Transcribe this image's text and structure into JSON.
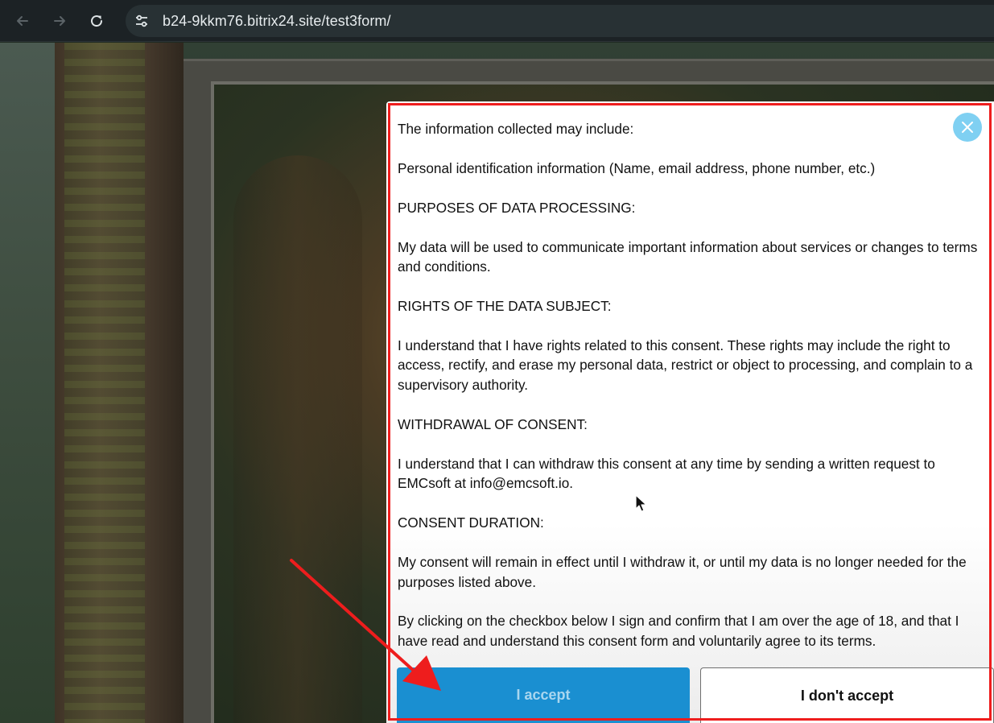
{
  "browser": {
    "url": "b24-9kkm76.bitrix24.site/test3form/"
  },
  "consent": {
    "paragraphs": [
      "The information collected may include:",
      "Personal identification information (Name, email address, phone number, etc.)",
      "PURPOSES OF DATA PROCESSING:",
      "My data will be used to communicate important information about services or changes to terms and conditions.",
      "RIGHTS OF THE DATA SUBJECT:",
      "I understand that I have rights related to this consent. These rights may include the right to access, rectify, and erase my personal data, restrict or object to processing, and complain to a supervisory authority.",
      "WITHDRAWAL OF CONSENT:",
      "I understand that I can withdraw this consent at any time by sending a written request to EMCsoft at info@emcsoft.io.",
      "CONSENT DURATION:",
      "My consent will remain in effect until I withdraw it, or until my data is no longer needed for the purposes listed above.",
      "By clicking on the checkbox below I sign and confirm that I am over the age of 18, and that I have read and understand this consent form and voluntarily agree to its terms."
    ],
    "accept_label": "I accept",
    "decline_label": "I don't accept"
  },
  "colors": {
    "accent_blue": "#1a8fd1",
    "close_button": "#7fd0f2",
    "annotation_red": "#ee1d1d"
  },
  "icons": {
    "back": "arrow-left-icon",
    "forward": "arrow-right-icon",
    "reload": "reload-icon",
    "site_info": "tune-icon",
    "close": "close-icon",
    "cursor": "mouse-cursor-icon"
  }
}
